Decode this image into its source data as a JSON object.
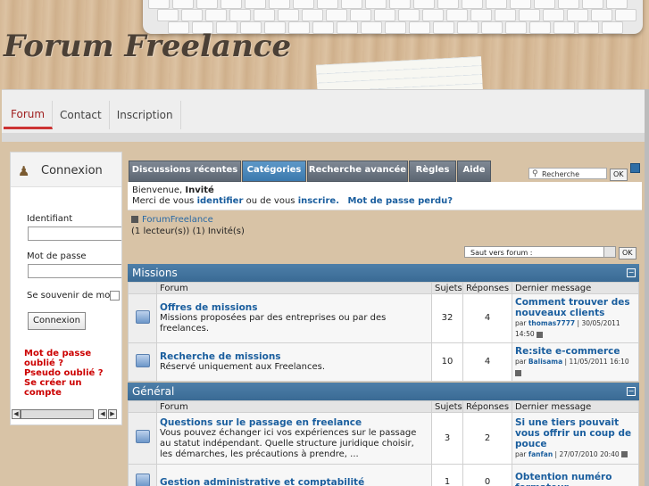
{
  "header": {
    "logo_text": "Forum Freelance"
  },
  "nav": {
    "tabs": [
      "Forum",
      "Contact",
      "Inscription"
    ],
    "active": "Forum"
  },
  "login": {
    "title": "Connexion",
    "username_label": "Identifiant",
    "password_label": "Mot de passe",
    "remember_label": "Se souvenir de moi",
    "submit_label": "Connexion",
    "links": [
      "Mot de passe oublié ?",
      "Pseudo oublié ?",
      "Se créer un compte"
    ]
  },
  "forum_tabs": [
    "Discussions récentes",
    "Catégories",
    "Recherche avancée",
    "Règles",
    "Aide"
  ],
  "active_tab": "Catégories",
  "search": {
    "placeholder": "Recherche",
    "ok_label": "OK"
  },
  "welcome": {
    "line1_prefix": "Bienvenue,",
    "user": "Invité",
    "line2_prefix": "Merci de vous",
    "identify": "identifier",
    "or": "ou de vous",
    "register": "inscrire.",
    "lost_password": "Mot de passe perdu?"
  },
  "breadcrumb": {
    "forum_name": "ForumFreelance",
    "readers": "(1 lecteur(s)) (1) Invité(s)"
  },
  "jump": {
    "label": "Saut vers forum :",
    "ok_label": "OK"
  },
  "columns": {
    "forum": "Forum",
    "topics": "Sujets",
    "replies": "Réponses",
    "last": "Dernier message"
  },
  "sections": [
    {
      "title": "Missions",
      "forums": [
        {
          "title": "Offres de missions",
          "desc": "Missions proposées par des entreprises ou par des freelances.",
          "topics": "32",
          "replies": "4",
          "last_title": "Comment trouver des nouveaux clients",
          "last_by": "thomas7777",
          "last_date": "30/05/2011 14:50"
        },
        {
          "title": "Recherche de missions",
          "desc": "Réservé uniquement aux Freelances.",
          "topics": "10",
          "replies": "4",
          "last_title": "Re:site e-commerce",
          "last_by": "Balisama",
          "last_date": "11/05/2011 16:10"
        }
      ]
    },
    {
      "title": "Général",
      "forums": [
        {
          "title": "Questions sur le passage en freelance",
          "desc": "Vous pouvez échanger ici vos expériences sur le passage au statut indépendant. Quelle structure juridique choisir, les démarches, les précautions à prendre, ...",
          "topics": "3",
          "replies": "2",
          "last_title": "Si une tiers pouvait vous offrir un coup de pouce",
          "last_by": "fanfan",
          "last_date": "27/07/2010 20:40"
        },
        {
          "title": "Gestion administrative et comptabilité",
          "desc": "",
          "topics": "1",
          "replies": "0",
          "last_title": "Obtention numéro formateur",
          "last_by": "",
          "last_date": ""
        }
      ]
    }
  ],
  "by_label": "par",
  "collapse_glyph": "−"
}
